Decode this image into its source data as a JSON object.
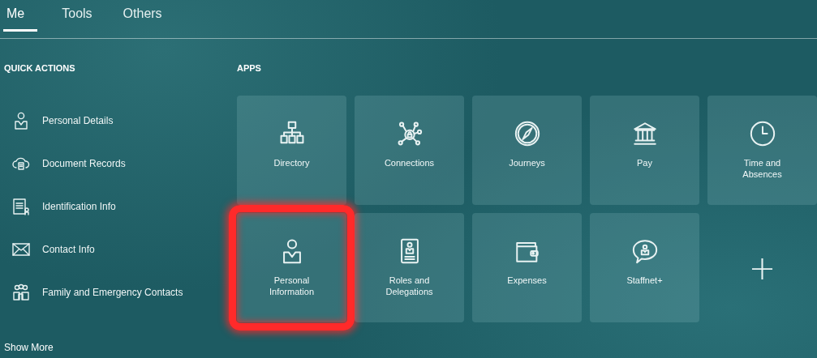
{
  "tabs": [
    {
      "label": "Me",
      "selected": true
    },
    {
      "label": "Tools",
      "selected": false
    },
    {
      "label": "Others",
      "selected": false
    }
  ],
  "quick_actions": {
    "title": "QUICK ACTIONS",
    "items": [
      {
        "label": "Personal Details"
      },
      {
        "label": "Document Records"
      },
      {
        "label": "Identification Info"
      },
      {
        "label": "Contact Info"
      },
      {
        "label": "Family and Emergency Contacts"
      }
    ],
    "show_more": "Show More"
  },
  "apps": {
    "title": "APPS",
    "tiles": [
      {
        "kind": "app",
        "label": "Directory",
        "highlighted": false
      },
      {
        "kind": "app",
        "label": "Connections",
        "highlighted": false
      },
      {
        "kind": "app",
        "label": "Journeys",
        "highlighted": false
      },
      {
        "kind": "app",
        "label": "Pay",
        "highlighted": false
      },
      {
        "kind": "app",
        "label": "Time and Absences",
        "highlighted": false
      },
      {
        "kind": "app",
        "label": "Personal Information",
        "highlighted": true
      },
      {
        "kind": "app",
        "label": "Roles and Delegations",
        "highlighted": false
      },
      {
        "kind": "app",
        "label": "Expenses",
        "highlighted": false
      },
      {
        "kind": "app",
        "label": "Staffnet+",
        "highlighted": false
      },
      {
        "kind": "add",
        "label": "+"
      }
    ]
  }
}
